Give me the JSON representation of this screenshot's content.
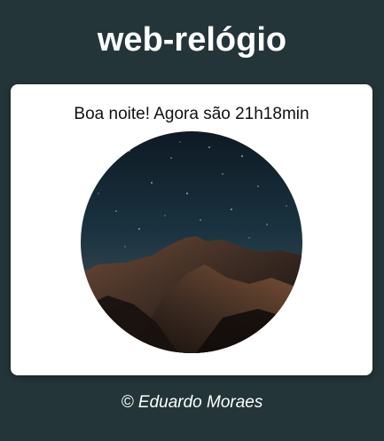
{
  "app": {
    "title": "web-relógio"
  },
  "card": {
    "greeting": "Boa noite! Agora são 21h18min",
    "image_subject": "night-sky-mountain"
  },
  "footer": {
    "credit": "© Eduardo Moraes"
  },
  "colors": {
    "background": "#233538",
    "card": "#ffffff",
    "title_text": "#ffffff",
    "greeting_text": "#111111"
  }
}
